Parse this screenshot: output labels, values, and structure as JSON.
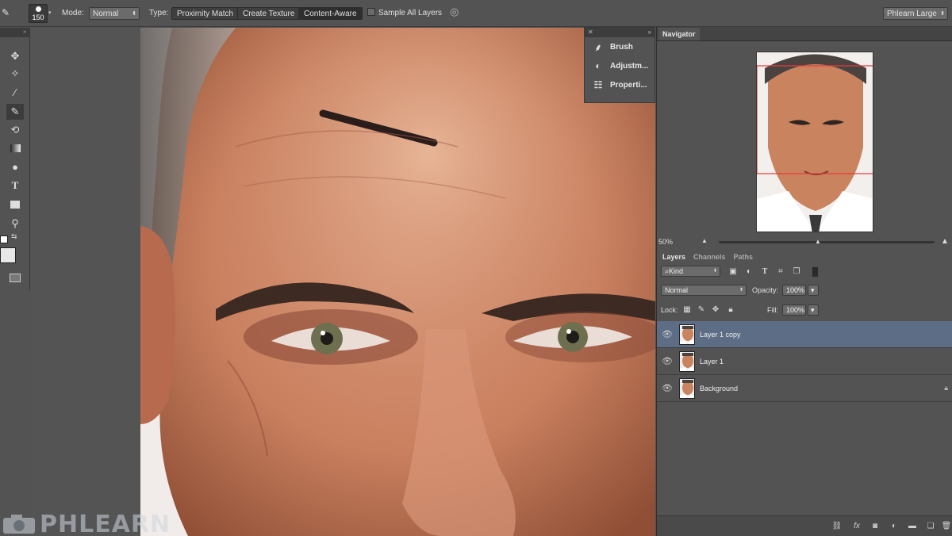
{
  "options_bar": {
    "brush_size": "150",
    "mode_label": "Mode:",
    "mode_value": "Normal",
    "type_label": "Type:",
    "type_buttons": [
      "Proximity Match",
      "Create Texture",
      "Content-Aware"
    ],
    "active_type": "Content-Aware",
    "sample_all_layers": "Sample All Layers",
    "workspace": "Phlearn Large"
  },
  "mini_panel": {
    "items": [
      {
        "label": "Brush",
        "icon": "brush-icon"
      },
      {
        "label": "Adjustm...",
        "icon": "adjustments-icon"
      },
      {
        "label": "Properti...",
        "icon": "properties-icon"
      }
    ]
  },
  "navigator": {
    "tab": "Navigator",
    "zoom": "50%"
  },
  "layers_panel": {
    "tabs": [
      "Layers",
      "Channels",
      "Paths"
    ],
    "filter_kind": "Kind",
    "blend_mode": "Normal",
    "opacity_label": "Opacity:",
    "opacity_value": "100%",
    "lock_label": "Lock:",
    "fill_label": "Fill:",
    "fill_value": "100%",
    "layers": [
      {
        "name": "Layer 1 copy",
        "selected": true,
        "locked": false
      },
      {
        "name": "Layer 1",
        "selected": false,
        "locked": false
      },
      {
        "name": "Background",
        "selected": false,
        "locked": true
      }
    ]
  },
  "watermark": "PHLEARN",
  "colors": {
    "panel_bg": "#535353",
    "selected_layer": "#5d6d85",
    "navigator_box": "#e83a3a"
  }
}
